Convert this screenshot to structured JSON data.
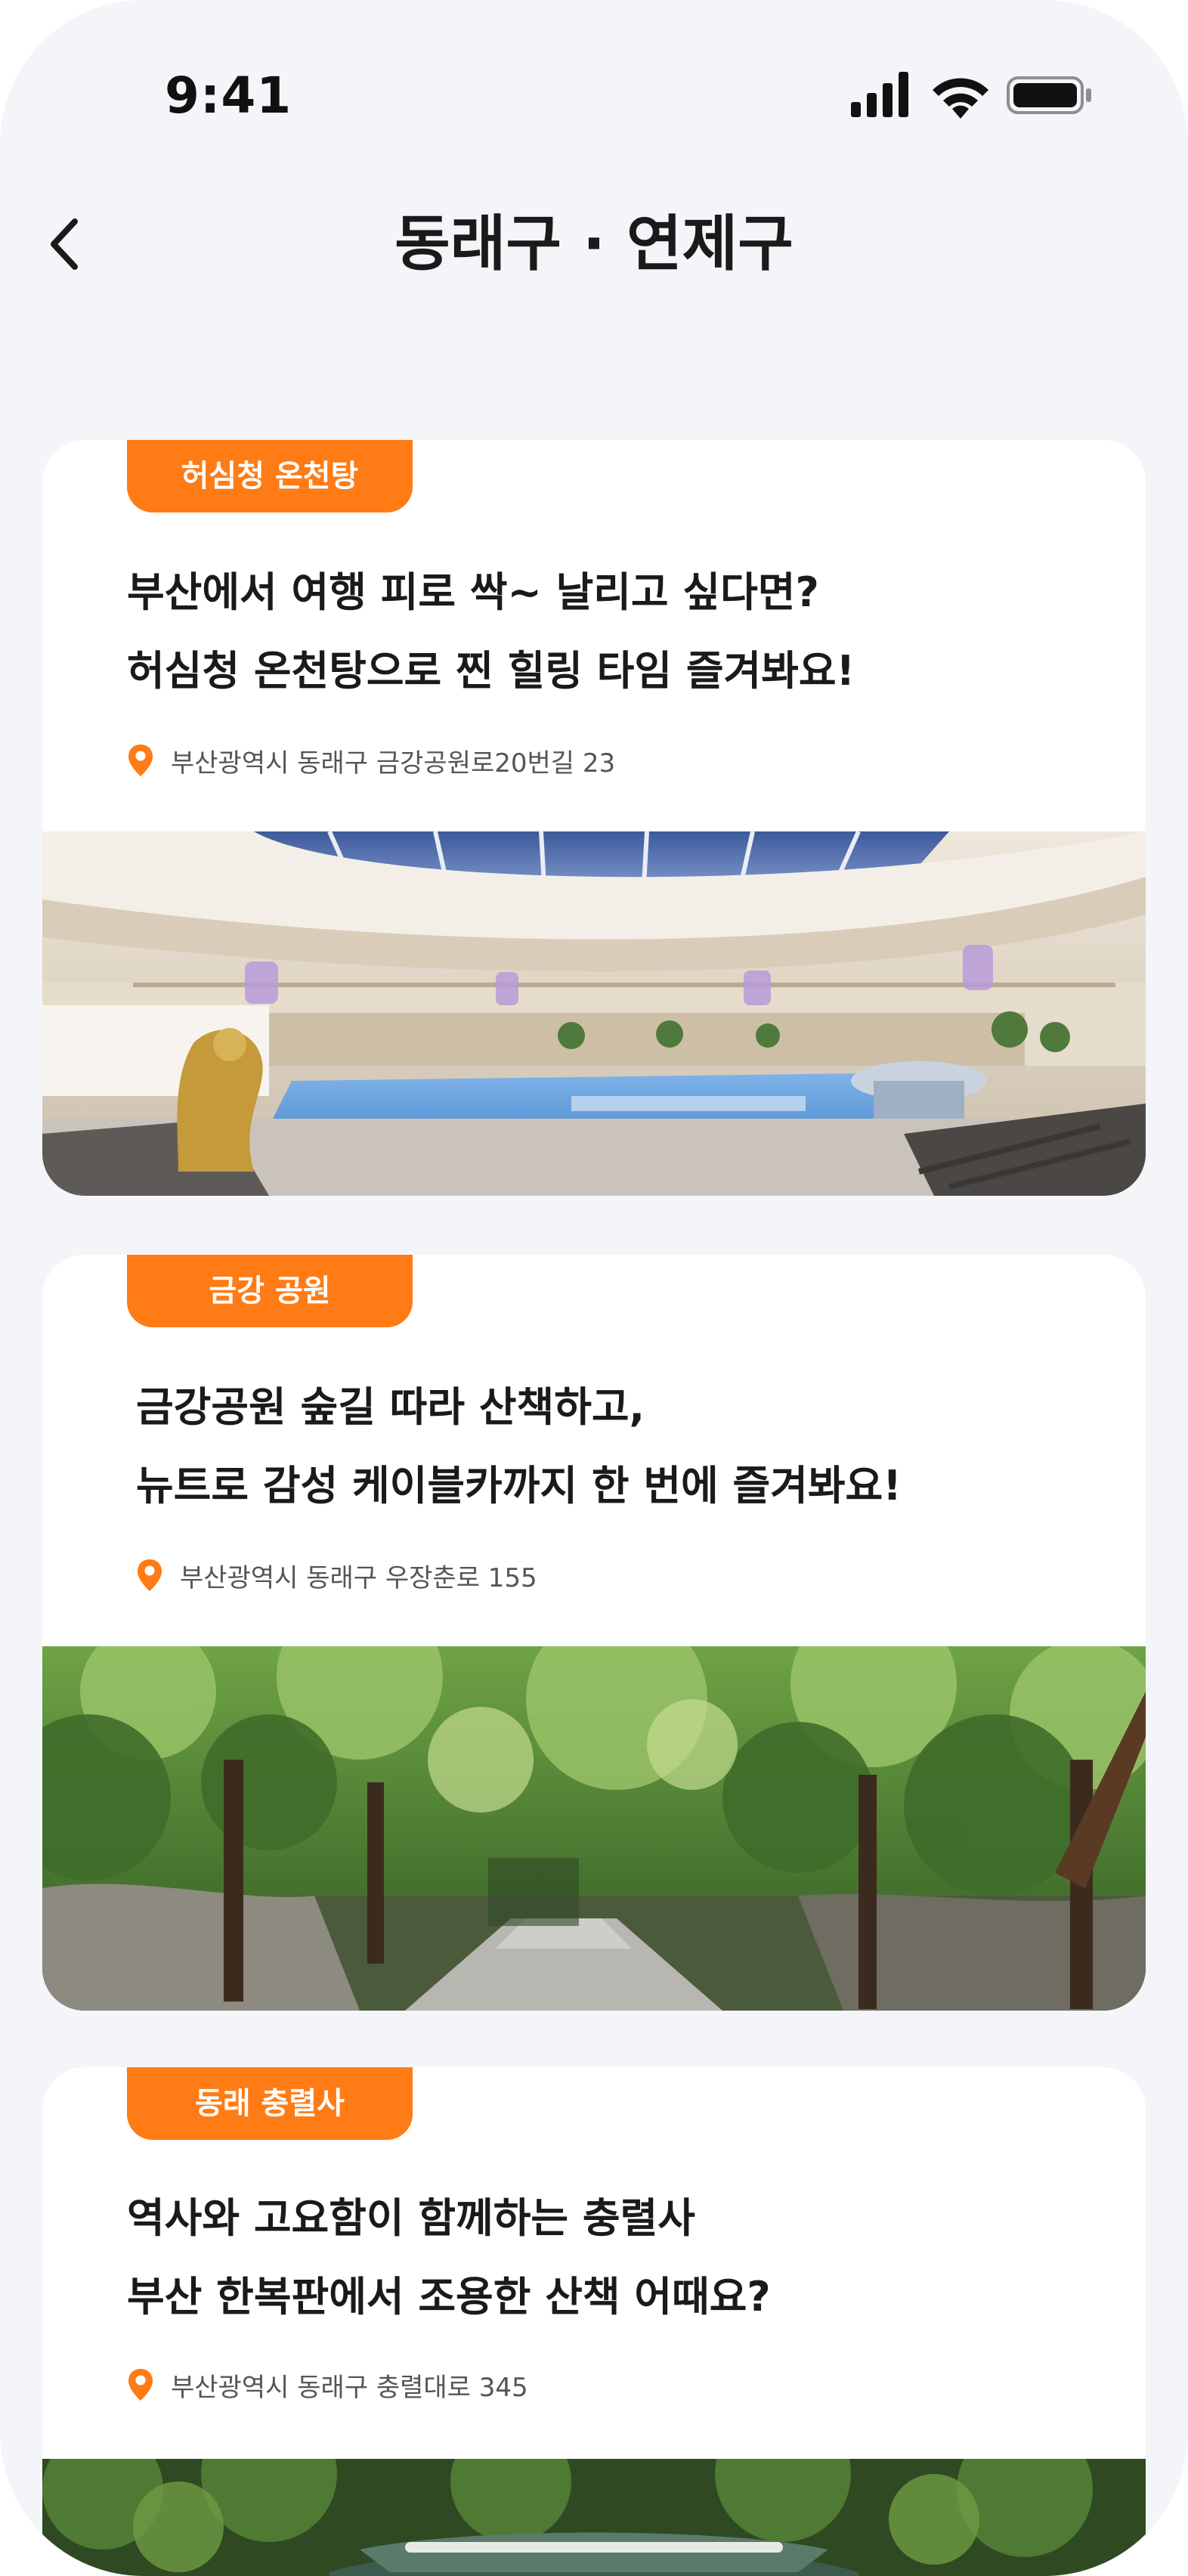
{
  "status_bar": {
    "time": "9:41"
  },
  "header": {
    "title": "동래구 · 연제구"
  },
  "cards": [
    {
      "tag": "허심청 온천탕",
      "headline_line1": "부산에서 여행 피로 싹~ 날리고 싶다면?",
      "headline_line2": "허심청 온천탕으로 찐 힐링 타임 즐겨봐요!",
      "address": "부산광역시 동래구 금강공원로20번길 23"
    },
    {
      "tag": "금강 공원",
      "headline_line1": "금강공원 숲길 따라 산책하고,",
      "headline_line2": "뉴트로 감성 케이블카까지 한 번에 즐겨봐요!",
      "address": "부산광역시 동래구 우장춘로 155"
    },
    {
      "tag": "동래 충렬사",
      "headline_line1": "역사와 고요함이 함께하는 충렬사",
      "headline_line2": "부산 한복판에서 조용한 산책 어때요?",
      "address": "부산광역시 동래구 충렬대로 345"
    }
  ],
  "colors": {
    "accent": "#ff7b15",
    "background": "#f4f5f9",
    "card": "#ffffff",
    "text": "#1a1a1a"
  },
  "icons": {
    "back": "chevron-left-icon",
    "location": "location-pin-icon",
    "signal": "cellular-signal-icon",
    "wifi": "wifi-icon",
    "battery": "battery-icon"
  }
}
